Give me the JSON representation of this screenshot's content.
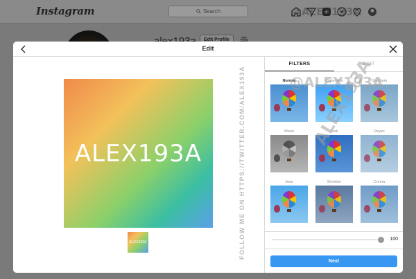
{
  "app": {
    "logo": "Instagram",
    "search_placeholder": "Search"
  },
  "nav_icons": [
    "home-icon",
    "direct-icon",
    "new-post-icon",
    "explore-icon",
    "activity-icon",
    "profile-icon"
  ],
  "profile": {
    "username": "alex193a",
    "edit_profile_label": "Edit Profile"
  },
  "modal": {
    "title": "Edit",
    "image_text": "ALEX193A",
    "thumb_text": "ALEX193A",
    "tabs": [
      {
        "label": "FILTERS",
        "active": true
      },
      {
        "label": "EDIT",
        "active": false
      }
    ],
    "filters": [
      {
        "name": "Normal",
        "selected": true,
        "tone": "normal"
      },
      {
        "name": "Clarendon",
        "selected": false,
        "tone": "clarendon"
      },
      {
        "name": "Gingham",
        "selected": false,
        "tone": "gingham"
      },
      {
        "name": "Moon",
        "selected": false,
        "tone": "moon"
      },
      {
        "name": "Lark",
        "selected": false,
        "tone": "lark"
      },
      {
        "name": "Reyes",
        "selected": false,
        "tone": "reyes"
      },
      {
        "name": "Juno",
        "selected": false,
        "tone": "juno"
      },
      {
        "name": "Slumber",
        "selected": false,
        "tone": "slumber"
      },
      {
        "name": "Crema",
        "selected": false,
        "tone": "crema"
      }
    ],
    "intensity": 100,
    "intensity_label": "100",
    "next_label": "Next"
  },
  "watermarks": {
    "vertical": "FOLLOW ME ON HTTPS://TWITTER.COM/ALEX193A",
    "handle": "@ALEX193A",
    "name": "ALEX193A"
  },
  "colors": {
    "accent": "#3897f0",
    "text": "#262626",
    "muted": "#8e8e8e"
  }
}
